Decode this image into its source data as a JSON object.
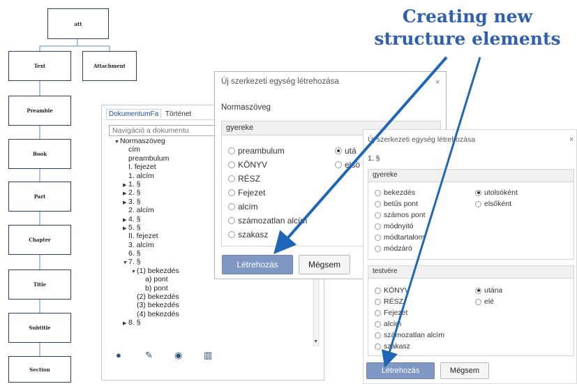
{
  "diagram": {
    "root": "att",
    "children": [
      "Text",
      "Attachment"
    ],
    "chain": [
      "Preamble",
      "Book",
      "Part",
      "Chapter",
      "Title",
      "Subtitle",
      "Section"
    ]
  },
  "tree_panel": {
    "tabs": [
      "DokumentumFa",
      "Történet"
    ],
    "search_placeholder": "Navigáció a dokumentu",
    "rows": [
      {
        "text": "Normaszöveg",
        "toggle": "open",
        "indent": 0
      },
      {
        "text": "cím",
        "toggle": "",
        "indent": 1
      },
      {
        "text": "preambulum",
        "toggle": "",
        "indent": 1
      },
      {
        "text": "I. fejezet",
        "toggle": "",
        "indent": 1
      },
      {
        "text": "1. alcím",
        "toggle": "",
        "indent": 1
      },
      {
        "text": "1. §",
        "toggle": "closed",
        "indent": 1
      },
      {
        "text": "2. §",
        "toggle": "closed",
        "indent": 1
      },
      {
        "text": "3. §",
        "toggle": "closed",
        "indent": 1
      },
      {
        "text": "2. alcím",
        "toggle": "",
        "indent": 1
      },
      {
        "text": "4. §",
        "toggle": "closed",
        "indent": 1
      },
      {
        "text": "5. §",
        "toggle": "closed",
        "indent": 1
      },
      {
        "text": "II. fejezet",
        "toggle": "",
        "indent": 1
      },
      {
        "text": "3. alcím",
        "toggle": "",
        "indent": 1
      },
      {
        "text": "6. §",
        "toggle": "",
        "indent": 1
      },
      {
        "text": "7. §",
        "toggle": "open",
        "indent": 1
      },
      {
        "text": "(1) bekezdés",
        "toggle": "open",
        "indent": 2
      },
      {
        "text": "a) pont",
        "toggle": "",
        "indent": 3
      },
      {
        "text": "b) pont",
        "toggle": "",
        "indent": 3
      },
      {
        "text": "(2) bekezdés",
        "toggle": "",
        "indent": 2
      },
      {
        "text": "(3) bekezdés",
        "toggle": "",
        "indent": 2
      },
      {
        "text": "(4) bekezdés",
        "toggle": "",
        "indent": 2
      },
      {
        "text": "8. §",
        "toggle": "closed",
        "indent": 1
      }
    ],
    "footer_icons": [
      "add-icon",
      "link-icon",
      "view-icon",
      "institution-icon"
    ]
  },
  "dialog1": {
    "title": "Új szerkezeti egység létrehozása",
    "close": "×",
    "subtitle": "Normaszöveg",
    "group": "gyereke",
    "options_left": [
      "preambulum",
      "KÖNYV",
      "RÉSZ",
      "Fejezet",
      "alcím",
      "számozatlan alcím",
      "szakasz"
    ],
    "options_right": [
      "utá",
      "elsö"
    ],
    "selected_right": 0,
    "create": "Létrehozás",
    "cancel": "Mégsem"
  },
  "dialog2": {
    "title": "Új szerkezeti egység létrehozása",
    "close": "×",
    "subtitle": "1. §",
    "group1": "gyereke",
    "group1_left": [
      "bekezdés",
      "betűs pont",
      "számos pont",
      "módnyitó",
      "módtartalom",
      "módzáró"
    ],
    "group1_right": [
      "utolsóként",
      "elsőként"
    ],
    "group2": "testvére",
    "group2_left": [
      "KÖNYV",
      "RÉSZ",
      "Fejezet",
      "alcím",
      "számozatlan alcím",
      "szakasz"
    ],
    "group2_right": [
      "utána",
      "elé"
    ],
    "create": "Létrehozás",
    "cancel": "Mégsem"
  },
  "caption": {
    "line1": "Creating new",
    "line2": "structure elements",
    "color": "#2f5fae"
  },
  "colors": {
    "node_border": "#2a3f5f",
    "connector": "#7ea0cc",
    "primary_button": "#7f97c2",
    "arrow": "#1f66b8"
  }
}
